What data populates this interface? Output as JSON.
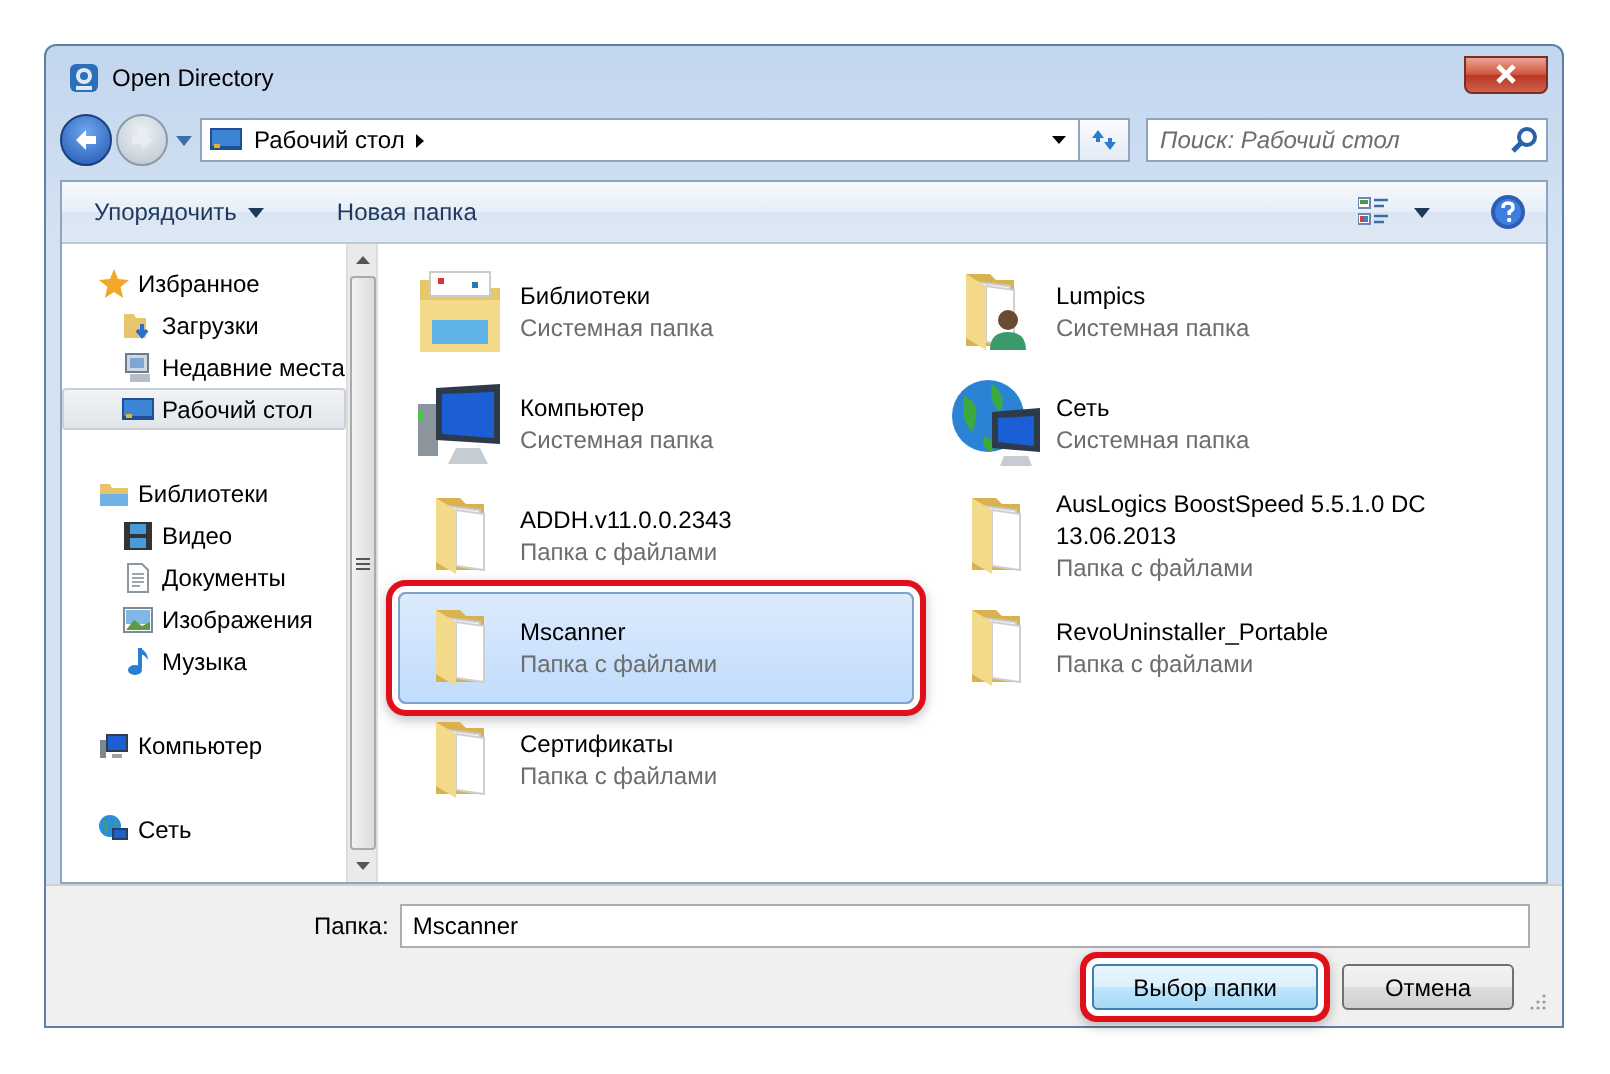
{
  "window": {
    "title": "Open Directory"
  },
  "address": {
    "path": "Рабочий стол"
  },
  "search": {
    "placeholder": "Поиск: Рабочий стол"
  },
  "toolbar": {
    "buttons": [
      {
        "label": "Упорядочить",
        "dropdown": true
      },
      {
        "label": "Новая папка",
        "dropdown": false
      }
    ]
  },
  "sidebar": {
    "groups": [
      {
        "label": "Избранное",
        "kind": "star",
        "children": [
          {
            "label": "Загрузки",
            "kind": "downloads",
            "selected": false
          },
          {
            "label": "Недавние места",
            "kind": "recent",
            "selected": false
          },
          {
            "label": "Рабочий стол",
            "kind": "desktop",
            "selected": true
          }
        ]
      },
      {
        "label": "Библиотеки",
        "kind": "library",
        "children": [
          {
            "label": "Видео",
            "kind": "video",
            "selected": false
          },
          {
            "label": "Документы",
            "kind": "document",
            "selected": false
          },
          {
            "label": "Изображения",
            "kind": "image",
            "selected": false
          },
          {
            "label": "Музыка",
            "kind": "music",
            "selected": false
          }
        ]
      },
      {
        "label": "Компьютер",
        "kind": "computer"
      },
      {
        "label": "Сеть",
        "kind": "network"
      }
    ]
  },
  "items": [
    {
      "name": "Библиотеки",
      "type": "Системная папка",
      "kind": "library",
      "selected": false,
      "highlighted": false
    },
    {
      "name": "Компьютер",
      "type": "Системная папка",
      "kind": "computer",
      "selected": false,
      "highlighted": false
    },
    {
      "name": "ADDH.v11.0.0.2343",
      "type": "Папка с файлами",
      "kind": "folder",
      "selected": false,
      "highlighted": false
    },
    {
      "name": "Mscanner",
      "type": "Папка с файлами",
      "kind": "folder",
      "selected": true,
      "highlighted": true
    },
    {
      "name": "Сертификаты",
      "type": "Папка с файлами",
      "kind": "folder",
      "selected": false,
      "highlighted": false
    },
    {
      "name": "Lumpics",
      "type": "Системная папка",
      "kind": "user",
      "selected": false,
      "highlighted": false
    },
    {
      "name": "Сеть",
      "type": "Системная папка",
      "kind": "network",
      "selected": false,
      "highlighted": false
    },
    {
      "name": "AusLogics BoostSpeed 5.5.1.0 DC 13.06.2013",
      "type": "Папка с файлами",
      "kind": "folder",
      "selected": false,
      "highlighted": false
    },
    {
      "name": "RevoUninstaller_Portable",
      "type": "Папка с файлами",
      "kind": "folder",
      "selected": false,
      "highlighted": false
    }
  ],
  "folder_field": {
    "label": "Папка:",
    "value": "Mscanner"
  },
  "buttons": [
    {
      "label": "Выбор папки",
      "kind": "primary",
      "highlighted": true
    },
    {
      "label": "Отмена",
      "kind": "secondary",
      "highlighted": false
    }
  ]
}
